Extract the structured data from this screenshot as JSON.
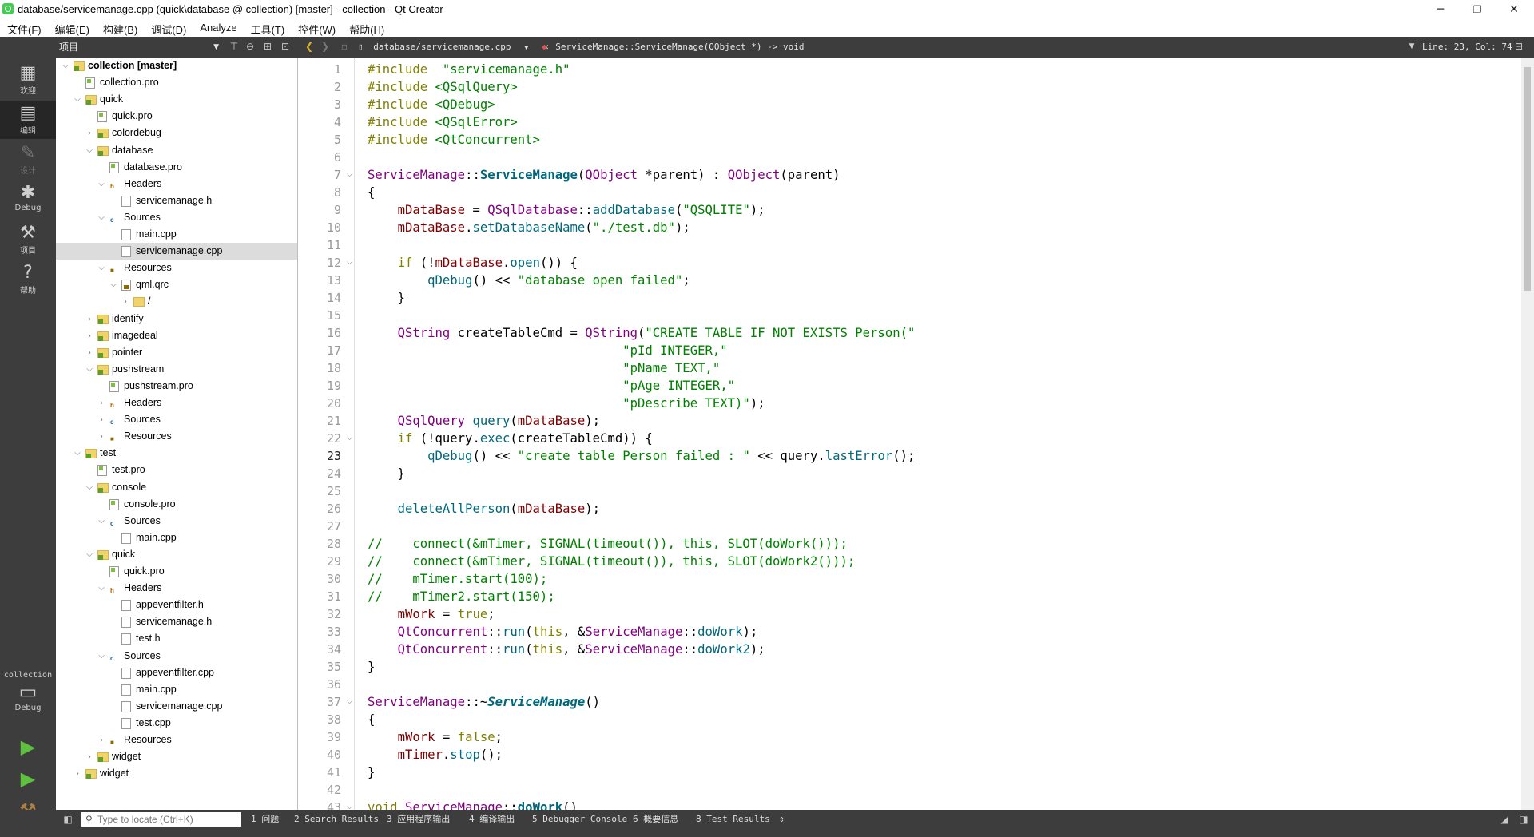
{
  "window": {
    "title": "database/servicemanage.cpp (quick\\database @ collection) [master] - collection - Qt Creator",
    "minimize": "─",
    "maximize": "❐",
    "close": "✕"
  },
  "menu": [
    "文件(F)",
    "编辑(E)",
    "构建(B)",
    "调试(D)",
    "Analyze",
    "工具(T)",
    "控件(W)",
    "帮助(H)"
  ],
  "toolbar": {
    "project_selector": "项目",
    "file_tab": "database/servicemanage.cpp",
    "function_selector": "ServiceManage::ServiceManage(QObject *) -> void",
    "line_col": "Line: 23, Col: 74"
  },
  "modes": [
    {
      "label": "欢迎",
      "icon": "grid-icon"
    },
    {
      "label": "编辑",
      "icon": "edit-icon"
    },
    {
      "label": "设计",
      "icon": "pen-icon"
    },
    {
      "label": "Debug",
      "icon": "bug-icon"
    },
    {
      "label": "项目",
      "icon": "wrench-icon"
    },
    {
      "label": "帮助",
      "icon": "help-icon"
    }
  ],
  "kit": {
    "project": "collection",
    "config": "Debug"
  },
  "tree": [
    {
      "d": 0,
      "arrow": "v",
      "icon": "proj",
      "label": "collection [master]",
      "bold": true
    },
    {
      "d": 1,
      "arrow": "",
      "icon": "pro",
      "label": "collection.pro"
    },
    {
      "d": 1,
      "arrow": "v",
      "icon": "proj",
      "label": "quick"
    },
    {
      "d": 2,
      "arrow": "",
      "icon": "pro",
      "label": "quick.pro"
    },
    {
      "d": 2,
      "arrow": ">",
      "icon": "proj",
      "label": "colordebug"
    },
    {
      "d": 2,
      "arrow": "v",
      "icon": "proj",
      "label": "database"
    },
    {
      "d": 3,
      "arrow": "",
      "icon": "pro",
      "label": "database.pro"
    },
    {
      "d": 3,
      "arrow": "v",
      "icon": "hdr",
      "label": "Headers"
    },
    {
      "d": 4,
      "arrow": "",
      "icon": "file",
      "label": "servicemanage.h"
    },
    {
      "d": 3,
      "arrow": "v",
      "icon": "src",
      "label": "Sources"
    },
    {
      "d": 4,
      "arrow": "",
      "icon": "file",
      "label": "main.cpp"
    },
    {
      "d": 4,
      "arrow": "",
      "icon": "file",
      "label": "servicemanage.cpp",
      "selected": true
    },
    {
      "d": 3,
      "arrow": "v",
      "icon": "res",
      "label": "Resources"
    },
    {
      "d": 4,
      "arrow": "v",
      "icon": "qrc",
      "label": "qml.qrc"
    },
    {
      "d": 5,
      "arrow": ">",
      "icon": "folder",
      "label": "/"
    },
    {
      "d": 2,
      "arrow": ">",
      "icon": "proj",
      "label": "identify"
    },
    {
      "d": 2,
      "arrow": ">",
      "icon": "proj",
      "label": "imagedeal"
    },
    {
      "d": 2,
      "arrow": ">",
      "icon": "proj",
      "label": "pointer"
    },
    {
      "d": 2,
      "arrow": "v",
      "icon": "proj",
      "label": "pushstream"
    },
    {
      "d": 3,
      "arrow": "",
      "icon": "pro",
      "label": "pushstream.pro"
    },
    {
      "d": 3,
      "arrow": ">",
      "icon": "hdr",
      "label": "Headers"
    },
    {
      "d": 3,
      "arrow": ">",
      "icon": "src",
      "label": "Sources"
    },
    {
      "d": 3,
      "arrow": ">",
      "icon": "res",
      "label": "Resources"
    },
    {
      "d": 1,
      "arrow": "v",
      "icon": "proj",
      "label": "test"
    },
    {
      "d": 2,
      "arrow": "",
      "icon": "pro",
      "label": "test.pro"
    },
    {
      "d": 2,
      "arrow": "v",
      "icon": "proj",
      "label": "console"
    },
    {
      "d": 3,
      "arrow": "",
      "icon": "pro",
      "label": "console.pro"
    },
    {
      "d": 3,
      "arrow": "v",
      "icon": "src",
      "label": "Sources"
    },
    {
      "d": 4,
      "arrow": "",
      "icon": "file",
      "label": "main.cpp"
    },
    {
      "d": 2,
      "arrow": "v",
      "icon": "proj",
      "label": "quick"
    },
    {
      "d": 3,
      "arrow": "",
      "icon": "pro",
      "label": "quick.pro"
    },
    {
      "d": 3,
      "arrow": "v",
      "icon": "hdr",
      "label": "Headers"
    },
    {
      "d": 4,
      "arrow": "",
      "icon": "file",
      "label": "appeventfilter.h"
    },
    {
      "d": 4,
      "arrow": "",
      "icon": "file",
      "label": "servicemanage.h"
    },
    {
      "d": 4,
      "arrow": "",
      "icon": "file",
      "label": "test.h"
    },
    {
      "d": 3,
      "arrow": "v",
      "icon": "src",
      "label": "Sources"
    },
    {
      "d": 4,
      "arrow": "",
      "icon": "file",
      "label": "appeventfilter.cpp"
    },
    {
      "d": 4,
      "arrow": "",
      "icon": "file",
      "label": "main.cpp"
    },
    {
      "d": 4,
      "arrow": "",
      "icon": "file",
      "label": "servicemanage.cpp"
    },
    {
      "d": 4,
      "arrow": "",
      "icon": "file",
      "label": "test.cpp"
    },
    {
      "d": 3,
      "arrow": ">",
      "icon": "res",
      "label": "Resources"
    },
    {
      "d": 2,
      "arrow": ">",
      "icon": "proj",
      "label": "widget"
    },
    {
      "d": 1,
      "arrow": ">",
      "icon": "proj",
      "label": "widget"
    }
  ],
  "editor": {
    "current_line": 23,
    "fold_lines": [
      7,
      12,
      22,
      37,
      43
    ],
    "lines": [
      [
        [
          "kw",
          "#include"
        ],
        [
          "",
          "  "
        ],
        [
          "str",
          "\"servicemanage.h\""
        ]
      ],
      [
        [
          "kw",
          "#include"
        ],
        [
          "",
          ""
        ],
        [
          "str",
          " <QSqlQuery>"
        ]
      ],
      [
        [
          "kw",
          "#include"
        ],
        [
          "str",
          " <QDebug>"
        ]
      ],
      [
        [
          "kw",
          "#include"
        ],
        [
          "str",
          " <QSqlError>"
        ]
      ],
      [
        [
          "kw",
          "#include"
        ],
        [
          "str",
          " <QtConcurrent>"
        ]
      ],
      [],
      [
        [
          "ty",
          "ServiceManage"
        ],
        [
          "",
          "::"
        ],
        [
          "bf",
          "ServiceManage"
        ],
        [
          "",
          "("
        ],
        [
          "ty",
          "QObject"
        ],
        [
          "",
          " *parent) : "
        ],
        [
          "ty",
          "QObject"
        ],
        [
          "",
          "(parent)"
        ]
      ],
      [
        [
          "",
          "{"
        ]
      ],
      [
        [
          "",
          "    "
        ],
        [
          "mem",
          "mDataBase"
        ],
        [
          "",
          " = "
        ],
        [
          "ty",
          "QSqlDatabase"
        ],
        [
          "",
          "::"
        ],
        [
          "fn",
          "addDatabase"
        ],
        [
          "",
          "("
        ],
        [
          "str",
          "\"QSQLITE\""
        ],
        [
          "",
          ");"
        ]
      ],
      [
        [
          "",
          "    "
        ],
        [
          "mem",
          "mDataBase"
        ],
        [
          "",
          "."
        ],
        [
          "fn",
          "setDatabaseName"
        ],
        [
          "",
          "("
        ],
        [
          "str",
          "\"./test.db\""
        ],
        [
          "",
          ");"
        ]
      ],
      [],
      [
        [
          "",
          "    "
        ],
        [
          "kw",
          "if"
        ],
        [
          "",
          " (!"
        ],
        [
          "mem",
          "mDataBase"
        ],
        [
          "",
          "."
        ],
        [
          "fn",
          "open"
        ],
        [
          "",
          "()) {"
        ]
      ],
      [
        [
          "",
          "        "
        ],
        [
          "fn",
          "qDebug"
        ],
        [
          "",
          "() << "
        ],
        [
          "str",
          "\"database open failed\""
        ],
        [
          "",
          ";"
        ]
      ],
      [
        [
          "",
          "    }"
        ]
      ],
      [],
      [
        [
          "",
          "    "
        ],
        [
          "ty",
          "QString"
        ],
        [
          "",
          " createTableCmd = "
        ],
        [
          "ty",
          "QString"
        ],
        [
          "",
          "("
        ],
        [
          "str",
          "\"CREATE TABLE IF NOT EXISTS Person(\""
        ]
      ],
      [
        [
          "",
          "                                  "
        ],
        [
          "str",
          "\"pId INTEGER,\""
        ]
      ],
      [
        [
          "",
          "                                  "
        ],
        [
          "str",
          "\"pName TEXT,\""
        ]
      ],
      [
        [
          "",
          "                                  "
        ],
        [
          "str",
          "\"pAge INTEGER,\""
        ]
      ],
      [
        [
          "",
          "                                  "
        ],
        [
          "str",
          "\"pDescribe TEXT)\""
        ],
        [
          "",
          "); "
        ]
      ],
      [
        [
          "",
          "    "
        ],
        [
          "ty",
          "QSqlQuery"
        ],
        [
          "",
          " "
        ],
        [
          "fn",
          "query"
        ],
        [
          "",
          "("
        ],
        [
          "mem",
          "mDataBase"
        ],
        [
          "",
          ");"
        ]
      ],
      [
        [
          "",
          "    "
        ],
        [
          "kw",
          "if"
        ],
        [
          "",
          " (!query."
        ],
        [
          "fn",
          "exec"
        ],
        [
          "",
          "(createTableCmd)) {"
        ]
      ],
      [
        [
          "",
          "        "
        ],
        [
          "fn",
          "qDebug"
        ],
        [
          "",
          "() << "
        ],
        [
          "str",
          "\"create table Person failed : \""
        ],
        [
          "",
          " << query."
        ],
        [
          "fn",
          "lastError"
        ],
        [
          "",
          "();"
        ]
      ],
      [
        [
          "",
          "    }"
        ]
      ],
      [],
      [
        [
          "",
          "    "
        ],
        [
          "fn",
          "deleteAllPerson"
        ],
        [
          "",
          "("
        ],
        [
          "mem",
          "mDataBase"
        ],
        [
          "",
          ");"
        ]
      ],
      [],
      [
        [
          "cmt",
          "//    connect(&mTimer, SIGNAL(timeout()), this, SLOT(doWork()));"
        ]
      ],
      [
        [
          "cmt",
          "//    connect(&mTimer, SIGNAL(timeout()), this, SLOT(doWork2()));"
        ]
      ],
      [
        [
          "cmt",
          "//    mTimer.start(100);"
        ]
      ],
      [
        [
          "cmt",
          "//    mTimer2.start(150);"
        ]
      ],
      [
        [
          "",
          "    "
        ],
        [
          "mem",
          "mWork"
        ],
        [
          "",
          " = "
        ],
        [
          "kw",
          "true"
        ],
        [
          "",
          ";"
        ]
      ],
      [
        [
          "",
          "    "
        ],
        [
          "ty",
          "QtConcurrent"
        ],
        [
          "",
          "::"
        ],
        [
          "fn",
          "run"
        ],
        [
          "",
          "("
        ],
        [
          "kw",
          "this"
        ],
        [
          "",
          ", &"
        ],
        [
          "ty",
          "ServiceManage"
        ],
        [
          "",
          "::"
        ],
        [
          "fn",
          "doWork"
        ],
        [
          "",
          ");"
        ]
      ],
      [
        [
          "",
          "    "
        ],
        [
          "ty",
          "QtConcurrent"
        ],
        [
          "",
          "::"
        ],
        [
          "fn",
          "run"
        ],
        [
          "",
          "("
        ],
        [
          "kw",
          "this"
        ],
        [
          "",
          ", &"
        ],
        [
          "ty",
          "ServiceManage"
        ],
        [
          "",
          "::"
        ],
        [
          "fn",
          "doWork2"
        ],
        [
          "",
          ");"
        ]
      ],
      [
        [
          "",
          "}"
        ]
      ],
      [],
      [
        [
          "ty",
          "ServiceManage"
        ],
        [
          "",
          "::~"
        ],
        [
          "bi",
          "ServiceManage"
        ],
        [
          "",
          "()"
        ]
      ],
      [
        [
          "",
          "{"
        ]
      ],
      [
        [
          "",
          "    "
        ],
        [
          "mem",
          "mWork"
        ],
        [
          "",
          " = "
        ],
        [
          "kw",
          "false"
        ],
        [
          "",
          ";"
        ]
      ],
      [
        [
          "",
          "    "
        ],
        [
          "mem",
          "mTimer"
        ],
        [
          "",
          "."
        ],
        [
          "fn",
          "stop"
        ],
        [
          "",
          "();"
        ]
      ],
      [
        [
          "",
          "}"
        ]
      ],
      [],
      [
        [
          "kw",
          "void"
        ],
        [
          "",
          " "
        ],
        [
          "ty",
          "ServiceManage"
        ],
        [
          "",
          "::"
        ],
        [
          "bf",
          "doWork"
        ],
        [
          "",
          "()"
        ]
      ]
    ]
  },
  "statusbar": {
    "locate_placeholder": "Type to locate (Ctrl+K)",
    "panes": [
      "1 问题",
      "2 Search Results",
      "3 应用程序输出",
      "4 编译输出",
      "5 Debugger Console",
      "6 概要信息",
      "8 Test Results"
    ]
  }
}
